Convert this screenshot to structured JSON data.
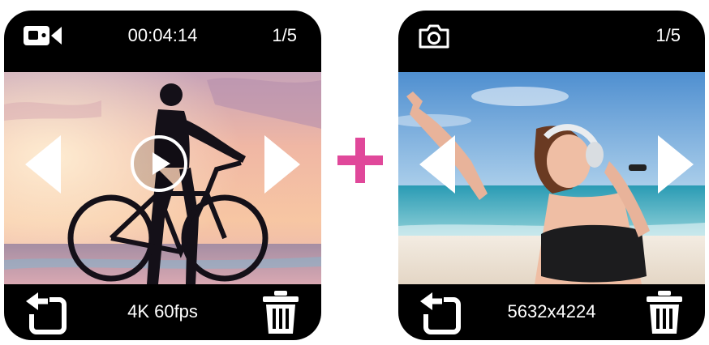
{
  "video_screen": {
    "mode_icon": "video-camera-icon",
    "timer": "00:04:14",
    "counter": "1/5",
    "info": "4K 60fps",
    "center_icon": "play-icon",
    "prev_icon": "chevron-left-icon",
    "next_icon": "chevron-right-icon",
    "back_icon": "return-arrow-icon",
    "delete_icon": "trash-icon"
  },
  "photo_screen": {
    "mode_icon": "camera-icon",
    "counter": "1/5",
    "info": "5632x4224",
    "prev_icon": "chevron-left-icon",
    "next_icon": "chevron-right-icon",
    "back_icon": "return-arrow-icon",
    "delete_icon": "trash-icon"
  },
  "connector_icon": "plus-icon",
  "colors": {
    "screen_background": "#000000",
    "text": "#ffffff",
    "plus_accent": "#e0489a"
  }
}
